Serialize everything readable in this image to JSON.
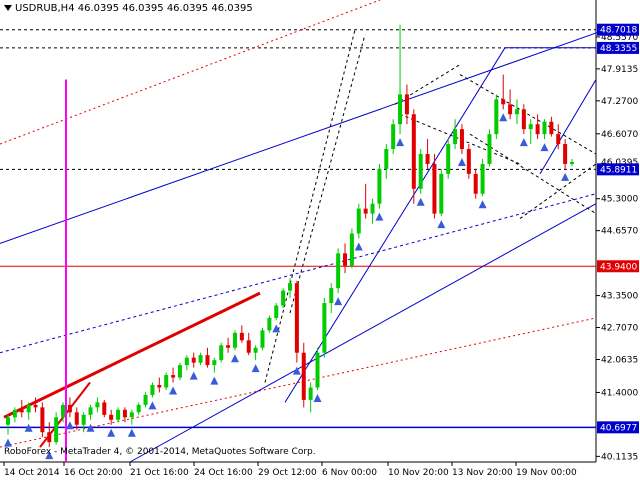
{
  "header": {
    "symbol": "USDRUB,H4",
    "values": "46.0395 46.0395 46.0395 46.0395"
  },
  "copyright": "RoboForex - MetaTrader 4, © 2001-2014, MetaQuotes Software Corp.",
  "colors": {
    "bull": "#00cc00",
    "bear": "#e00000",
    "trend_blue": "#0000cc",
    "level_red": "#e00000",
    "marker_magenta": "#ff00ff",
    "arrow_blue": "#3a5bd9"
  },
  "chart_data": {
    "type": "candlestick",
    "ylim": [
      40.1135,
      49.0
    ],
    "y_ticks": [
      "48.5570",
      "47.9135",
      "47.2700",
      "46.6070",
      "45.3000",
      "44.6570",
      "43.3500",
      "42.7070",
      "42.0635",
      "41.4000",
      "40.1135"
    ],
    "x_ticks": [
      "14 Oct 2014",
      "16 Oct 20:00",
      "21 Oct 16:00",
      "24 Oct 16:00",
      "29 Oct 12:00",
      "6 Nov 00:00",
      "10 Nov 20:00",
      "13 Nov 20:00",
      "19 Nov 00:00"
    ],
    "price_labels": [
      {
        "label": "48.7018",
        "value": 48.7018,
        "color": "#0000cc"
      },
      {
        "label": "48.3355",
        "value": 48.3355,
        "color": "#0000cc"
      },
      {
        "label": "46.0395",
        "value": 46.0395,
        "color": "#000000"
      },
      {
        "label": "45.8911",
        "value": 45.8911,
        "color": "#0000cc"
      },
      {
        "label": "43.9400",
        "value": 43.94,
        "color": "#e00000"
      },
      {
        "label": "40.6977",
        "value": 40.6977,
        "color": "#0000cc"
      }
    ],
    "candles": [
      [
        40.75,
        40.95,
        40.55,
        40.9
      ],
      [
        40.9,
        41.1,
        40.8,
        41.05
      ],
      [
        41.05,
        41.25,
        40.9,
        41.0
      ],
      [
        41.0,
        41.2,
        40.85,
        41.15
      ],
      [
        41.15,
        41.3,
        41.0,
        41.1
      ],
      [
        41.1,
        41.2,
        40.5,
        40.6
      ],
      [
        40.6,
        40.8,
        40.3,
        40.4
      ],
      [
        40.4,
        41.0,
        40.35,
        40.9
      ],
      [
        40.9,
        41.2,
        40.8,
        41.15
      ],
      [
        41.15,
        41.3,
        40.9,
        41.0
      ],
      [
        41.0,
        41.1,
        40.65,
        40.75
      ],
      [
        40.75,
        41.0,
        40.6,
        40.95
      ],
      [
        40.95,
        41.15,
        40.85,
        41.1
      ],
      [
        41.1,
        41.3,
        41.0,
        41.2
      ],
      [
        41.2,
        41.25,
        40.9,
        40.95
      ],
      [
        40.95,
        41.05,
        40.75,
        40.85
      ],
      [
        40.85,
        41.1,
        40.8,
        41.05
      ],
      [
        41.05,
        41.1,
        40.8,
        40.9
      ],
      [
        40.9,
        41.05,
        40.75,
        41.0
      ],
      [
        41.0,
        41.2,
        40.95,
        41.15
      ],
      [
        41.15,
        41.4,
        41.1,
        41.35
      ],
      [
        41.35,
        41.6,
        41.3,
        41.55
      ],
      [
        41.55,
        41.7,
        41.4,
        41.5
      ],
      [
        41.5,
        41.8,
        41.45,
        41.75
      ],
      [
        41.75,
        41.9,
        41.6,
        41.7
      ],
      [
        41.7,
        42.0,
        41.65,
        41.95
      ],
      [
        41.95,
        42.15,
        41.85,
        42.1
      ],
      [
        42.1,
        42.2,
        41.9,
        42.0
      ],
      [
        42.0,
        42.2,
        41.95,
        42.15
      ],
      [
        42.15,
        42.3,
        41.9,
        41.95
      ],
      [
        41.95,
        42.1,
        41.8,
        42.05
      ],
      [
        42.05,
        42.4,
        42.0,
        42.35
      ],
      [
        42.35,
        42.5,
        42.2,
        42.3
      ],
      [
        42.3,
        42.65,
        42.25,
        42.6
      ],
      [
        42.6,
        42.75,
        42.4,
        42.45
      ],
      [
        42.45,
        42.6,
        42.15,
        42.2
      ],
      [
        42.2,
        42.35,
        42.05,
        42.3
      ],
      [
        42.3,
        42.7,
        42.25,
        42.65
      ],
      [
        42.65,
        42.95,
        42.6,
        42.9
      ],
      [
        42.9,
        43.2,
        42.85,
        43.15
      ],
      [
        43.15,
        43.5,
        43.1,
        43.45
      ],
      [
        43.45,
        43.7,
        43.3,
        43.6
      ],
      [
        43.6,
        43.65,
        42.0,
        42.2
      ],
      [
        42.2,
        42.4,
        41.1,
        41.25
      ],
      [
        41.25,
        41.6,
        41.0,
        41.5
      ],
      [
        41.5,
        42.3,
        41.45,
        42.2
      ],
      [
        42.2,
        43.3,
        42.1,
        43.2
      ],
      [
        43.2,
        43.6,
        43.0,
        43.5
      ],
      [
        43.5,
        44.3,
        43.4,
        44.2
      ],
      [
        44.2,
        44.4,
        43.8,
        43.95
      ],
      [
        43.95,
        44.7,
        43.9,
        44.6
      ],
      [
        44.6,
        45.2,
        44.5,
        45.1
      ],
      [
        45.1,
        45.6,
        44.9,
        45.0
      ],
      [
        45.0,
        45.3,
        44.8,
        45.2
      ],
      [
        45.2,
        46.0,
        45.1,
        45.9
      ],
      [
        45.9,
        46.4,
        45.7,
        46.3
      ],
      [
        46.3,
        46.9,
        46.2,
        46.8
      ],
      [
        46.8,
        48.8,
        46.6,
        47.4
      ],
      [
        47.4,
        47.6,
        46.8,
        47.0
      ],
      [
        47.0,
        47.1,
        45.2,
        45.5
      ],
      [
        45.5,
        46.3,
        45.4,
        46.2
      ],
      [
        46.2,
        46.5,
        45.9,
        46.0
      ],
      [
        46.0,
        46.2,
        44.9,
        45.0
      ],
      [
        45.0,
        45.9,
        44.95,
        45.8
      ],
      [
        45.8,
        46.5,
        45.7,
        46.4
      ],
      [
        46.4,
        46.9,
        46.3,
        46.7
      ],
      [
        46.7,
        46.8,
        46.2,
        46.3
      ],
      [
        46.3,
        46.4,
        45.7,
        45.8
      ],
      [
        45.8,
        45.9,
        45.3,
        45.4
      ],
      [
        45.4,
        46.1,
        45.35,
        46.0
      ],
      [
        46.0,
        46.7,
        45.95,
        46.6
      ],
      [
        46.6,
        47.4,
        46.5,
        47.3
      ],
      [
        47.3,
        47.8,
        47.1,
        47.2
      ],
      [
        47.2,
        47.5,
        46.9,
        47.0
      ],
      [
        47.0,
        47.3,
        46.8,
        47.1
      ],
      [
        47.1,
        47.2,
        46.6,
        46.7
      ],
      [
        46.7,
        46.9,
        46.4,
        46.8
      ],
      [
        46.8,
        47.0,
        46.5,
        46.6
      ],
      [
        46.6,
        46.9,
        46.5,
        46.85
      ],
      [
        46.85,
        46.95,
        46.55,
        46.6
      ],
      [
        46.6,
        46.8,
        46.3,
        46.4
      ],
      [
        46.4,
        46.5,
        45.9,
        46.0
      ],
      [
        46.0,
        46.1,
        45.95,
        46.04
      ]
    ],
    "time_range": [
      0,
      100
    ]
  }
}
